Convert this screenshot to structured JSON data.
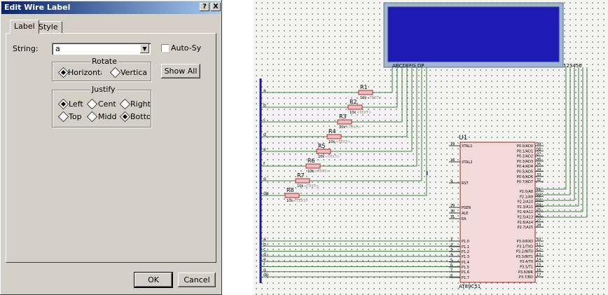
{
  "dialog": {
    "title": "Edit Wire Label",
    "help_button": "?",
    "close_button": "X",
    "tabs": [
      "Label",
      "Style"
    ],
    "string_label": "String:",
    "string_value": "a",
    "auto_sync_label": "Auto-Sync",
    "show_all_button": "Show All",
    "rotate": {
      "title": "Rotate",
      "options": [
        "Horizonta",
        "Vertica"
      ],
      "selected": "Horizonta"
    },
    "justify": {
      "title": "Justify",
      "options": [
        "Left",
        "Centr",
        "Right",
        "Top",
        "Midd",
        "Bottom"
      ],
      "selected": [
        "Left",
        "Bottom"
      ]
    },
    "ok_button": "OK",
    "cancel_button": "Cancel"
  },
  "schematic": {
    "display_labels": {
      "segments": "ABCDEFG  DP",
      "digits": "123456"
    },
    "chip": {
      "ref": "U1",
      "part": "AT89C51",
      "left_pins": [
        {
          "num": "19",
          "name": "XTAL1"
        },
        {
          "num": "18",
          "name": "XTAL2"
        },
        {
          "num": "9",
          "name": "RST"
        },
        {
          "num": "29",
          "name": "PSEN"
        },
        {
          "num": "30",
          "name": "ALE"
        },
        {
          "num": "31",
          "name": "EA"
        },
        {
          "num": "1",
          "name": "P1.0"
        },
        {
          "num": "2",
          "name": "P1.1"
        },
        {
          "num": "3",
          "name": "P1.2"
        },
        {
          "num": "4",
          "name": "P1.3"
        },
        {
          "num": "5",
          "name": "P1.4"
        },
        {
          "num": "6",
          "name": "P1.5"
        },
        {
          "num": "7",
          "name": "P1.6"
        },
        {
          "num": "8",
          "name": "P1.7"
        }
      ],
      "right_pins": [
        {
          "num": "39",
          "name": "P0.0/AD0"
        },
        {
          "num": "38",
          "name": "P0.1/AD1"
        },
        {
          "num": "37",
          "name": "P0.2/AD2"
        },
        {
          "num": "36",
          "name": "P0.3/AD3"
        },
        {
          "num": "35",
          "name": "P0.4/AD4"
        },
        {
          "num": "34",
          "name": "P0.5/AD5"
        },
        {
          "num": "33",
          "name": "P0.6/AD6"
        },
        {
          "num": "32",
          "name": "P0.7/AD7"
        },
        {
          "num": "21",
          "name": "P2.0/A8"
        },
        {
          "num": "22",
          "name": "P2.1/A9"
        },
        {
          "num": "23",
          "name": "P2.2/A10"
        },
        {
          "num": "24",
          "name": "P2.3/A11"
        },
        {
          "num": "25",
          "name": "P2.4/A12"
        },
        {
          "num": "26",
          "name": "P2.5/A13"
        },
        {
          "num": "27",
          "name": "P2.6/A14"
        },
        {
          "num": "28",
          "name": "P2.7/A15"
        },
        {
          "num": "10",
          "name": "P3.0/RXD"
        },
        {
          "num": "11",
          "name": "P3.1/TXD"
        },
        {
          "num": "12",
          "name": "P3.2/INT0"
        },
        {
          "num": "13",
          "name": "P3.3/INT1"
        },
        {
          "num": "14",
          "name": "P3.4/T0"
        },
        {
          "num": "15",
          "name": "P3.5/T1"
        },
        {
          "num": "16",
          "name": "P3.6/WR"
        },
        {
          "num": "17",
          "name": "P3.7/RD"
        }
      ]
    },
    "resistors": [
      {
        "ref": "R1",
        "value": "10k",
        "text": "<TEXT>"
      },
      {
        "ref": "R2",
        "value": "10k",
        "text": "<TEXT>"
      },
      {
        "ref": "R3",
        "value": "10k",
        "text": "<TEXT>"
      },
      {
        "ref": "R4",
        "value": "10k",
        "text": "<TEXT>"
      },
      {
        "ref": "R5",
        "value": "10k",
        "text": "<TEXT>"
      },
      {
        "ref": "R6",
        "value": "10k",
        "text": "<TEXT>"
      },
      {
        "ref": "R7",
        "value": "10k",
        "text": "<TEXT>"
      },
      {
        "ref": "R8",
        "value": "10k",
        "text": "<TEXT>"
      }
    ],
    "bus_labels_top": [
      "a",
      "b",
      "c",
      "d",
      "e",
      "f",
      "g",
      "dp"
    ],
    "bus_labels_bottom": [
      "a",
      "b",
      "c",
      "d",
      "e",
      "f",
      "g",
      "dp"
    ],
    "colors": {
      "display_bg": "#1c1cb4",
      "display_frame": "#9fb8d0",
      "wire": "#3f7f3f",
      "bus": "#1a1aa0",
      "resistor": "#b03030",
      "chip_body": "#f5dada",
      "chip_border": "#a02020"
    }
  }
}
